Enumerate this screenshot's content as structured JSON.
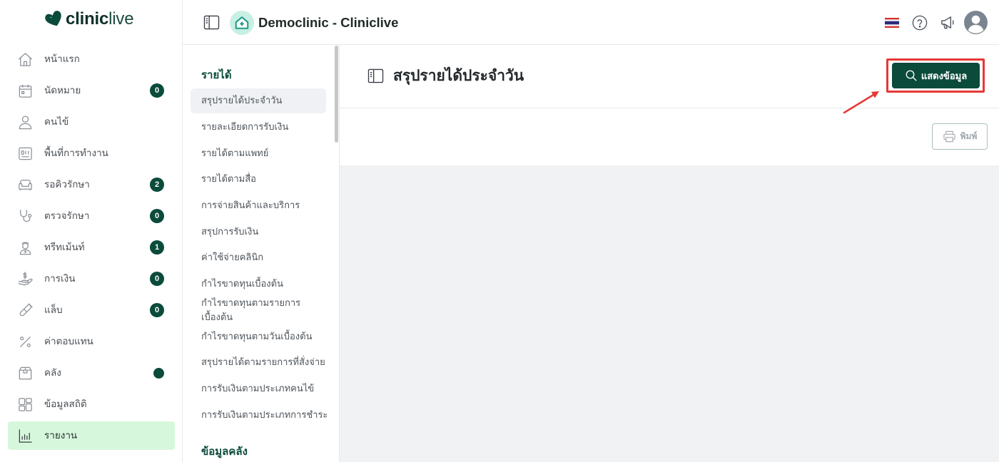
{
  "brand": {
    "logo_bold": "clinic",
    "logo_light": "live",
    "logo_icon": "cliniclive-heart-icon",
    "primary_color": "#0b4b3b",
    "active_bg_color": "#d7f7dc"
  },
  "sidebar": {
    "items": [
      {
        "label": "หน้าแรก",
        "icon": "home-icon"
      },
      {
        "label": "นัดหมาย",
        "icon": "calendar-icon",
        "badge": "0"
      },
      {
        "label": "คนไข้",
        "icon": "user-icon"
      },
      {
        "label": "พื้นที่การทำงาน",
        "icon": "workspace-icon"
      },
      {
        "label": "รอคิวรักษา",
        "icon": "sofa-icon",
        "badge": "2"
      },
      {
        "label": "ตรวจรักษา",
        "icon": "stethoscope-icon",
        "badge": "0"
      },
      {
        "label": "ทรีทเม้นท์",
        "icon": "doctor-icon",
        "badge": "1"
      },
      {
        "label": "การเงิน",
        "icon": "money-hand-icon",
        "badge": "0"
      },
      {
        "label": "แล็บ",
        "icon": "test-tube-icon",
        "badge": "0"
      },
      {
        "label": "ค่าตอบแทน",
        "icon": "percent-icon"
      },
      {
        "label": "คลัง",
        "icon": "box-icon",
        "dot": true
      },
      {
        "label": "ข้อมูลสถิติ",
        "icon": "grid-icon"
      },
      {
        "label": "รายงาน",
        "icon": "chart-icon",
        "active": true
      }
    ]
  },
  "header": {
    "title": "Democlinic - Cliniclive",
    "icons": {
      "toggle": "sidebar-toggle-icon",
      "clinic_logo": "clinic-house-icon",
      "language": "thai-flag-icon",
      "help": "help-icon",
      "announcements": "megaphone-icon",
      "profile": "avatar-icon"
    }
  },
  "report_menu": {
    "sections": [
      {
        "title": "รายได้",
        "items": [
          {
            "label": "สรุปรายได้ประจำวัน",
            "active": true
          },
          {
            "label": "รายละเอียดการรับเงิน"
          },
          {
            "label": "รายได้ตามแพทย์"
          },
          {
            "label": "รายได้ตามสื่อ"
          },
          {
            "label": "การจ่ายสินค้าและบริการ"
          },
          {
            "label": "สรุปการรับเงิน"
          },
          {
            "label": "ค่าใช้จ่ายคลินิก"
          },
          {
            "label": "กำไรขาดทุนเบื้องต้น"
          },
          {
            "label": "กำไรขาดทุนตามรายการเบื้องต้น"
          },
          {
            "label": "กำไรขาดทุนตามวันเบื้องต้น"
          },
          {
            "label": "สรุปรายได้ตามรายการที่สั่งจ่าย"
          },
          {
            "label": "การรับเงินตามประเภทคนไข้"
          },
          {
            "label": "การรับเงินตามประเภทการชำระ"
          }
        ]
      },
      {
        "title": "ข้อมูลคลัง"
      }
    ]
  },
  "page": {
    "title": "สรุปรายได้ประจำวัน",
    "title_icon": "report-panel-icon",
    "show_button": {
      "label": "แสดงข้อมูล",
      "icon": "search-icon"
    },
    "print_button": {
      "label": "พิมพ์",
      "icon": "printer-icon"
    }
  },
  "annotation": {
    "color": "#e53935"
  }
}
